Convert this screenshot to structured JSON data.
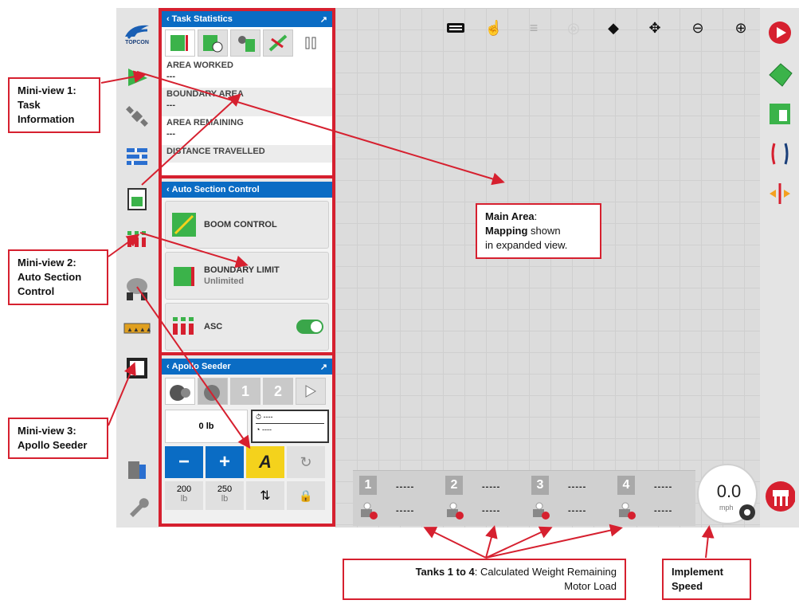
{
  "task_statistics": {
    "title": "Task Statistics",
    "stats": [
      {
        "label": "AREA WORKED",
        "value": "---"
      },
      {
        "label": "BOUNDARY AREA",
        "value": "---"
      },
      {
        "label": "AREA REMAINING",
        "value": "---"
      },
      {
        "label": "DISTANCE TRAVELLED",
        "value": ""
      }
    ]
  },
  "auto_section_control": {
    "title": "Auto Section Control",
    "boom_control": "BOOM CONTROL",
    "boundary_limit": "BOUNDARY LIMIT",
    "boundary_limit_value": "Unlimited",
    "asc": "ASC",
    "asc_on": true
  },
  "apollo_seeder": {
    "title": "Apollo Seeder",
    "tabs": [
      "1",
      "2"
    ],
    "weight": "0 lb",
    "stat_1": "----",
    "stat_2": "----",
    "minus": "−",
    "plus": "+",
    "preset_1_value": "200",
    "preset_1_unit": "lb",
    "preset_2_value": "250",
    "preset_2_unit": "lb"
  },
  "tanks": [
    {
      "number": "1",
      "weight": "-----",
      "motor": "-----"
    },
    {
      "number": "2",
      "weight": "-----",
      "motor": "-----"
    },
    {
      "number": "3",
      "weight": "-----",
      "motor": "-----"
    },
    {
      "number": "4",
      "weight": "-----",
      "motor": "-----"
    }
  ],
  "speed": {
    "value": "0.0",
    "unit": "mph"
  },
  "logo": "TOPCON",
  "callouts": {
    "mv1_line1": "Mini-view 1:",
    "mv1_line2": "Task",
    "mv1_line3": "Information",
    "mv2_line1": "Mini-view 2:",
    "mv2_line2": "Auto Section",
    "mv2_line3": "Control",
    "mv3_line1": "Mini-view 3:",
    "mv3_line2": "Apollo Seeder",
    "main_bold1": "Main Area",
    "main_colon": ":",
    "main_bold2": "Mapping",
    "main_rest1": " shown",
    "main_rest2": "in expanded view.",
    "tanks_bold": "Tanks 1 to 4",
    "tanks_rest1": ": Calculated Weight Remaining",
    "tanks_rest2": "Motor Load",
    "speed_line1": "Implement",
    "speed_line2": "Speed"
  },
  "colors": {
    "accent_red": "#d6202f",
    "header_blue": "#0a6cc4",
    "toggle_green": "#3aa64a"
  }
}
